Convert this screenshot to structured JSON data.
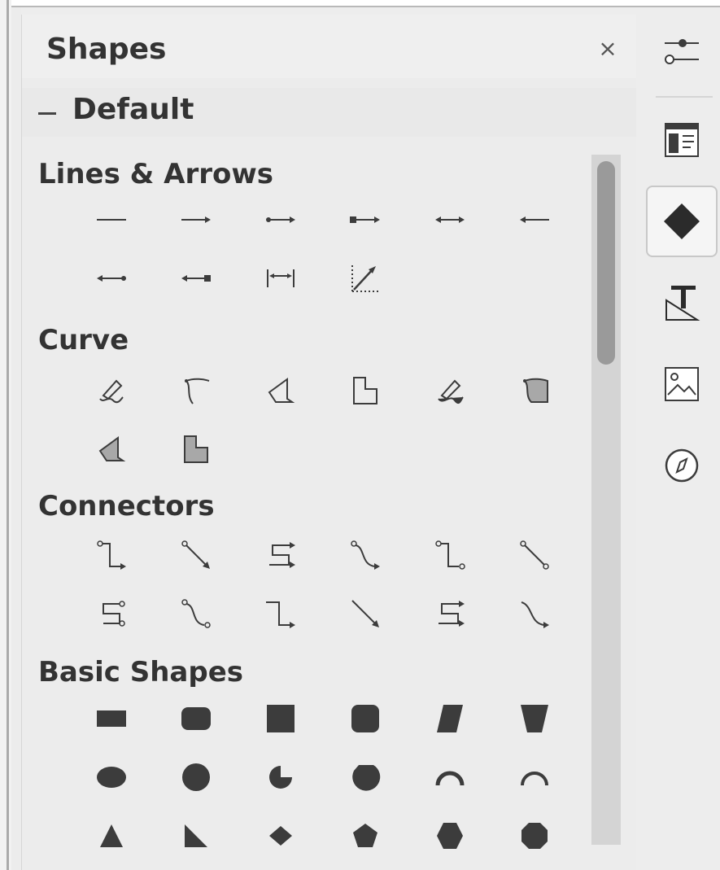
{
  "panel": {
    "title": "Shapes",
    "close_glyph": "×",
    "category": "Default",
    "sections": [
      {
        "title": "Lines & Arrows"
      },
      {
        "title": "Curve"
      },
      {
        "title": "Connectors"
      },
      {
        "title": "Basic Shapes"
      }
    ]
  },
  "sidebar": {
    "buttons": [
      {
        "icon": "properties-icon",
        "active": false
      },
      {
        "icon": "page-icon",
        "active": false
      },
      {
        "icon": "shapes-icon",
        "active": true
      },
      {
        "icon": "styles-icon",
        "active": false
      },
      {
        "icon": "gallery-icon",
        "active": false
      },
      {
        "icon": "navigator-icon",
        "active": false
      }
    ]
  },
  "colors": {
    "icon": "#3c3c3c",
    "icon_fill": "#a8a8a8",
    "panel_bg": "#ececec",
    "scroll_thumb": "#9a9a9a"
  }
}
